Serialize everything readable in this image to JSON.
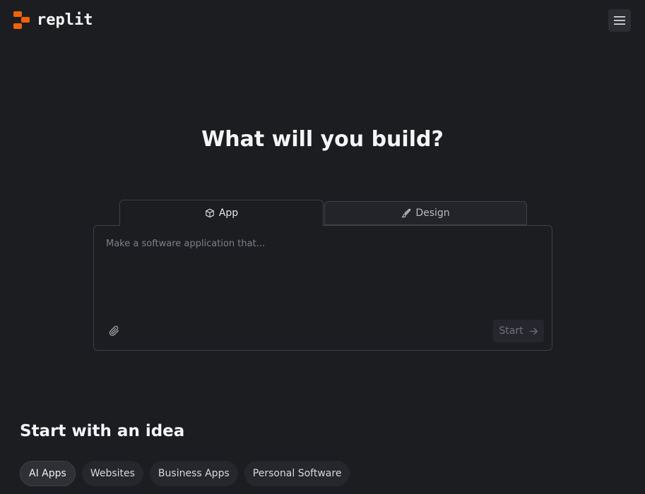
{
  "header": {
    "logo_text": "replit",
    "menu_icon": "hamburger-menu-icon"
  },
  "hero": {
    "title": "What will you build?"
  },
  "tabs": [
    {
      "label": "App",
      "icon": "cube-icon",
      "selected": true
    },
    {
      "label": "Design",
      "icon": "paintbrush-icon",
      "selected": false
    }
  ],
  "prompt": {
    "placeholder": "Make a software application that...",
    "value": "",
    "attach_icon": "paperclip-icon",
    "start_label": "Start",
    "start_icon": "arrow-right-icon"
  },
  "ideas": {
    "title": "Start with an idea",
    "chips": [
      "AI Apps",
      "Websites",
      "Business Apps",
      "Personal Software"
    ]
  },
  "colors": {
    "brand": "#f26207",
    "background": "#1c1d21"
  }
}
